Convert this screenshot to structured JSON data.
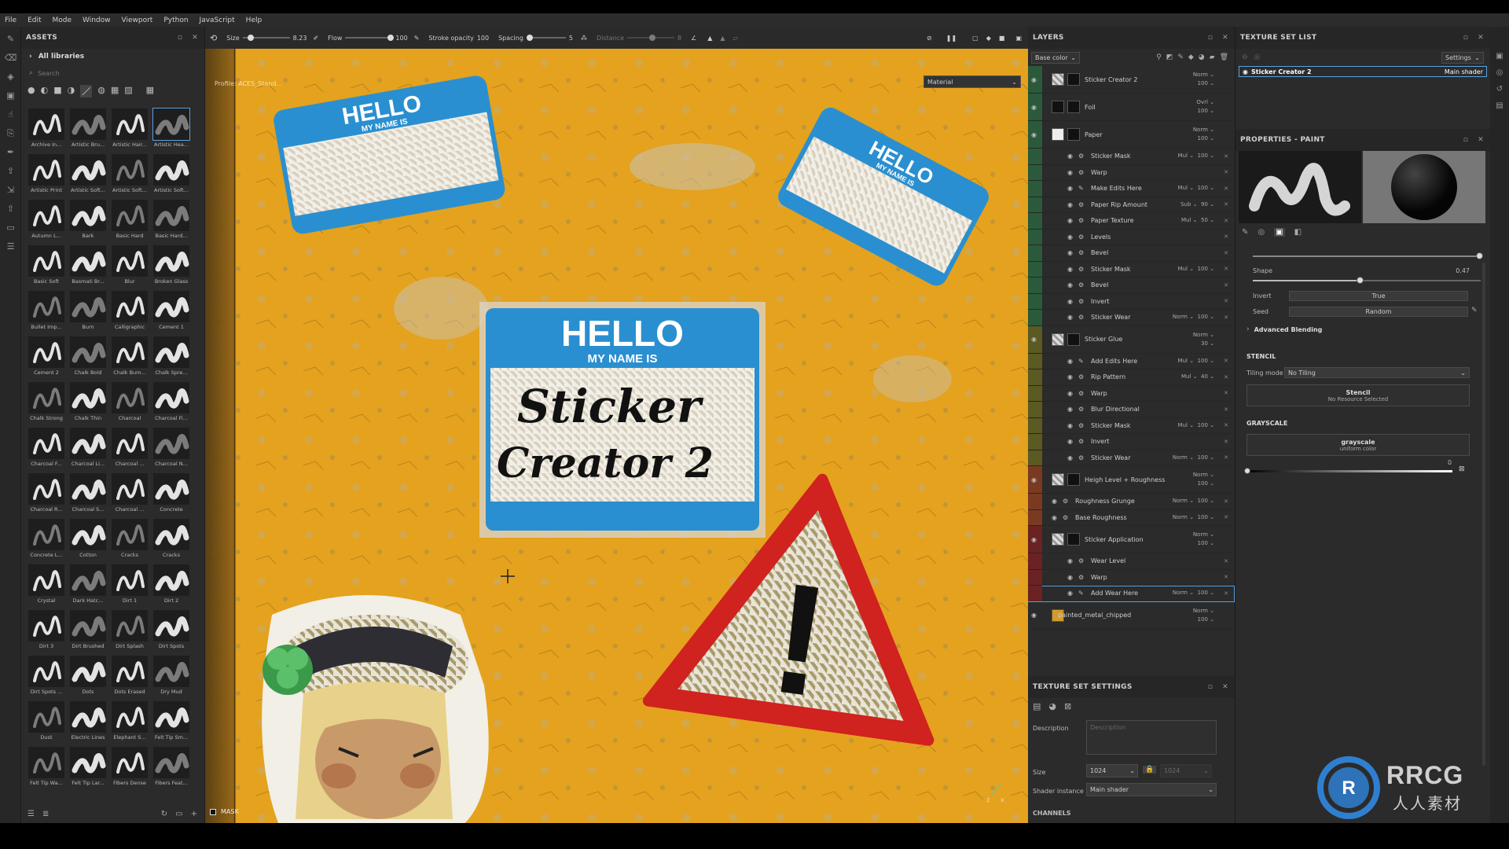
{
  "menu": [
    "File",
    "Edit",
    "Mode",
    "Window",
    "Viewport",
    "Python",
    "JavaScript",
    "Help"
  ],
  "assets": {
    "title": "ASSETS",
    "library": "All libraries",
    "search_placeholder": "Search",
    "brushes": [
      "Archive In...",
      "Artistic Bru...",
      "Artistic Hair...",
      "Artistic Hea...",
      "Artistic Print",
      "Artistic Soft...",
      "Artistic Soft...",
      "Artistic Soft...",
      "Autumn L...",
      "Bark",
      "Basic Hard",
      "Basic Hard...",
      "Basic Soft",
      "Basmati Br...",
      "Blur",
      "Broken Glass",
      "Bullet Imp...",
      "Burn",
      "Calligraphic",
      "Cement 1",
      "Cement 2",
      "Chalk Bold",
      "Chalk Bum...",
      "Chalk Spre...",
      "Chalk Strong",
      "Chalk Thin",
      "Charcoal",
      "Charcoal Fi...",
      "Charcoal F...",
      "Charcoal Li...",
      "Charcoal ...",
      "Charcoal N...",
      "Charcoal R...",
      "Charcoal S...",
      "Charcoal ...",
      "Concrete",
      "Concrete L...",
      "Cotton",
      "Cracks",
      "Cracks",
      "Crystal",
      "Dark Hatc...",
      "Dirt 1",
      "Dirt 2",
      "Dirt 3",
      "Dirt Brushed",
      "Dirt Splash",
      "Dirt Spots",
      "Dirt Spots ...",
      "Dots",
      "Dots Erased",
      "Dry Mud",
      "Dust",
      "Electric Lines",
      "Elephant S...",
      "Felt Tip Sm...",
      "Felt Tip Wa...",
      "Felt Tip Lar...",
      "Fibers Dense",
      "Fibers Feat..."
    ]
  },
  "toolbar": {
    "size_label": "Size",
    "size_value": "8.23",
    "flow_label": "Flow",
    "flow_value": "100",
    "stroke_label": "Stroke opacity",
    "stroke_value": "100",
    "spacing_label": "Spacing",
    "spacing_value": "5",
    "distance_label": "Distance",
    "distance_value": "8"
  },
  "viewport": {
    "material_dropdown": "Material",
    "profile_text": "Profile: ACES_Stand...",
    "mask_label": "MASK",
    "sticker_center_line1": "HELLO",
    "sticker_center_line2": "MY NAME IS",
    "handwriting_1": "Sticker",
    "handwriting_2": "Creator 2",
    "sticker_tl_line1": "HELLO",
    "sticker_tl_line2": "MY NAME IS",
    "sticker_tr_line1": "HELLO",
    "sticker_tr_line2": "MY NAME IS",
    "warning": "!"
  },
  "layers": {
    "title": "LAYERS",
    "channel": "Base color",
    "rows": [
      {
        "name": "Sticker Creator 2",
        "blend": "Norm",
        "opacity": "100",
        "type": "folder",
        "color": "#2a6a4a"
      },
      {
        "name": "Foil",
        "blend": "Ovrl",
        "opacity": "100",
        "type": "fill",
        "color": "#2a6a4a"
      },
      {
        "name": "Paper",
        "blend": "Norm",
        "opacity": "100",
        "type": "fill",
        "color": "#2a6a4a"
      },
      {
        "name": "Sticker Mask",
        "blend": "Mul",
        "opacity": "100",
        "type": "effect"
      },
      {
        "name": "Warp",
        "blend": "",
        "opacity": "",
        "type": "effect"
      },
      {
        "name": "Make Edits Here",
        "blend": "Mul",
        "opacity": "100",
        "type": "effect"
      },
      {
        "name": "Paper Rip Amount",
        "blend": "Sub",
        "opacity": "90",
        "type": "effect"
      },
      {
        "name": "Paper Texture",
        "blend": "Mul",
        "opacity": "50",
        "type": "effect"
      },
      {
        "name": "Levels",
        "blend": "",
        "opacity": "",
        "type": "effect"
      },
      {
        "name": "Bevel",
        "blend": "",
        "opacity": "",
        "type": "effect"
      },
      {
        "name": "Sticker Mask",
        "blend": "Mul",
        "opacity": "100",
        "type": "effect"
      },
      {
        "name": "Bevel",
        "blend": "",
        "opacity": "",
        "type": "effect"
      },
      {
        "name": "Invert",
        "blend": "",
        "opacity": "",
        "type": "effect"
      },
      {
        "name": "Sticker Wear",
        "blend": "Norm",
        "opacity": "100",
        "type": "effect"
      },
      {
        "name": "Sticker Glue",
        "blend": "Norm",
        "opacity": "30",
        "type": "fill",
        "color": "#6a6a2a"
      },
      {
        "name": "Add Edits Here",
        "blend": "Mul",
        "opacity": "100",
        "type": "effect"
      },
      {
        "name": "Rip Pattern",
        "blend": "Mul",
        "opacity": "40",
        "type": "effect"
      },
      {
        "name": "Warp",
        "blend": "",
        "opacity": "",
        "type": "effect"
      },
      {
        "name": "Blur Directional",
        "blend": "",
        "opacity": "",
        "type": "effect"
      },
      {
        "name": "Sticker Mask",
        "blend": "Mul",
        "opacity": "100",
        "type": "effect"
      },
      {
        "name": "Invert",
        "blend": "",
        "opacity": "",
        "type": "effect"
      },
      {
        "name": "Sticker Wear",
        "blend": "Norm",
        "opacity": "100",
        "type": "effect"
      },
      {
        "name": "Heigh Level + Roughness",
        "blend": "Norm",
        "opacity": "100",
        "type": "fill",
        "color": "#7a3a2a"
      },
      {
        "name": "Roughness Grunge",
        "blend": "Norm",
        "opacity": "100",
        "type": "effect2"
      },
      {
        "name": "Base Roughness",
        "blend": "Norm",
        "opacity": "100",
        "type": "effect2"
      },
      {
        "name": "Sticker Application",
        "blend": "Norm",
        "opacity": "100",
        "type": "fill",
        "color": "#7a2a2a"
      },
      {
        "name": "Wear Level",
        "blend": "",
        "opacity": "",
        "type": "effect"
      },
      {
        "name": "Warp",
        "blend": "",
        "opacity": "",
        "type": "effect"
      },
      {
        "name": "Add Wear Here",
        "blend": "Norm",
        "opacity": "100",
        "type": "effect",
        "active": true
      },
      {
        "name": "painted_metal_chipped",
        "blend": "Norm",
        "opacity": "100",
        "type": "base",
        "color": "#2b2b2b"
      }
    ]
  },
  "tss": {
    "title": "TEXTURE SET SETTINGS",
    "description_label": "Description",
    "description_placeholder": "Description",
    "size_label": "Size",
    "size_value": "1024",
    "size_value2": "1024",
    "shader_label": "Shader instance",
    "shader_value": "Main shader",
    "channels_label": "CHANNELS"
  },
  "texture_set_list": {
    "title": "TEXTURE SET LIST",
    "settings": "Settings",
    "item": "Sticker Creator 2",
    "shader": "Main shader"
  },
  "properties": {
    "title": "PROPERTIES - PAINT",
    "shape_label": "Shape",
    "shape_value": "0.47",
    "invert_label": "Invert",
    "invert_value": "True",
    "seed_label": "Seed",
    "seed_value": "Random",
    "advanced": "Advanced Blending",
    "stencil_title": "STENCIL",
    "tiling_label": "Tiling mode",
    "tiling_value": "No Tiling",
    "stencil_name": "Stencil",
    "stencil_sub": "No Resource Selected",
    "grayscale_title": "GRAYSCALE",
    "grayscale_name": "grayscale",
    "grayscale_sub": "uniform color",
    "grayscale_value": "0"
  },
  "watermark": {
    "brand": "RRCG",
    "sub": "人人素材"
  },
  "colors": {
    "accent": "#5aa0e0",
    "panel": "#2b2b2b",
    "metal": "#e4a21e",
    "sticker_blue": "#2a8fd0"
  }
}
